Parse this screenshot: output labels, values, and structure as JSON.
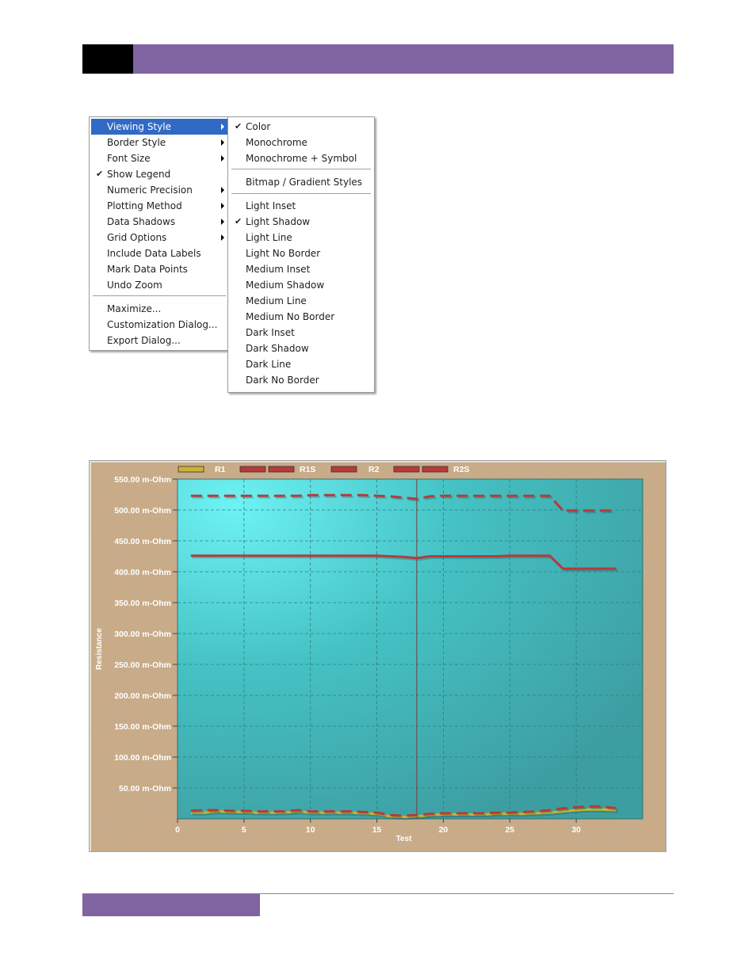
{
  "context_menu": {
    "items": [
      {
        "label": "Viewing Style",
        "submenu": true,
        "highlighted": true
      },
      {
        "label": "Border Style",
        "submenu": true
      },
      {
        "label": "Font Size",
        "submenu": true
      },
      {
        "label": "Show Legend",
        "checked": true
      },
      {
        "label": "Numeric Precision",
        "submenu": true
      },
      {
        "label": "Plotting Method",
        "submenu": true
      },
      {
        "label": "Data Shadows",
        "submenu": true
      },
      {
        "label": "Grid Options",
        "submenu": true
      },
      {
        "label": "Include Data Labels"
      },
      {
        "label": "Mark Data Points"
      },
      {
        "label": "Undo Zoom"
      },
      {
        "label": "Maximize..."
      },
      {
        "label": "Customization Dialog..."
      },
      {
        "label": "Export Dialog..."
      }
    ]
  },
  "viewing_style_submenu": {
    "items": [
      {
        "label": "Color",
        "checked": true
      },
      {
        "label": "Monochrome"
      },
      {
        "label": "Monochrome + Symbol"
      },
      {
        "label": "Bitmap / Gradient Styles"
      },
      {
        "label": "Light Inset"
      },
      {
        "label": "Light Shadow",
        "checked": true
      },
      {
        "label": "Light Line"
      },
      {
        "label": "Light No Border"
      },
      {
        "label": "Medium Inset"
      },
      {
        "label": "Medium Shadow"
      },
      {
        "label": "Medium Line"
      },
      {
        "label": "Medium No Border"
      },
      {
        "label": "Dark Inset"
      },
      {
        "label": "Dark Shadow"
      },
      {
        "label": "Dark Line"
      },
      {
        "label": "Dark No Border"
      }
    ]
  },
  "icons": {
    "check": "checkmark-icon",
    "submenu": "submenu-arrow-icon"
  },
  "colors": {
    "menu_highlight": "#316ac5",
    "header_purple": "#8064a2",
    "series_r1": "#c8b430",
    "series_r2": "#b83a3a"
  },
  "chart_data": {
    "type": "line",
    "xlabel": "Test",
    "ylabel": "Resistance",
    "xlim": [
      0,
      35
    ],
    "ylim": [
      0,
      550
    ],
    "x_ticks": [
      0,
      5,
      10,
      15,
      20,
      25,
      30
    ],
    "y_ticks": [
      {
        "value": 550,
        "label": "550.00 m-Ohm"
      },
      {
        "value": 500,
        "label": "500.00 m-Ohm"
      },
      {
        "value": 450,
        "label": "450.00 m-Ohm"
      },
      {
        "value": 400,
        "label": "400.00 m-Ohm"
      },
      {
        "value": 350,
        "label": "350.00 m-Ohm"
      },
      {
        "value": 300,
        "label": "300.00 m-Ohm"
      },
      {
        "value": 250,
        "label": "250.00 m-Ohm"
      },
      {
        "value": 200,
        "label": "200.00 m-Ohm"
      },
      {
        "value": 150,
        "label": "150.00 m-Ohm"
      },
      {
        "value": 100,
        "label": "100.00 m-Ohm"
      },
      {
        "value": 50,
        "label": "50.00 m-Ohm"
      }
    ],
    "grid": true,
    "legend_position": "top",
    "cursor_x": 18,
    "series": [
      {
        "name": "R1",
        "color": "#c8b430",
        "style": "solid",
        "x": [
          1,
          2,
          3,
          4,
          5,
          6,
          7,
          8,
          9,
          10,
          11,
          12,
          13,
          14,
          15,
          16,
          17,
          18,
          19,
          20,
          21,
          22,
          23,
          24,
          25,
          26,
          27,
          28,
          29,
          30,
          31,
          32,
          33
        ],
        "values": [
          10,
          10,
          12,
          11,
          11,
          10,
          10,
          10,
          12,
          10,
          10,
          10,
          10,
          9,
          8,
          4,
          3,
          4,
          6,
          7,
          7,
          7,
          7,
          8,
          8,
          8,
          9,
          10,
          12,
          14,
          15,
          15,
          14
        ]
      },
      {
        "name": "R1S",
        "color": "#b83a3a",
        "style": "dashed",
        "x": [
          1,
          2,
          3,
          4,
          5,
          6,
          7,
          8,
          9,
          10,
          11,
          12,
          13,
          14,
          15,
          16,
          17,
          18,
          19,
          20,
          21,
          22,
          23,
          24,
          25,
          26,
          27,
          28,
          29,
          30,
          31,
          32,
          33
        ],
        "values": [
          13,
          14,
          14,
          13,
          13,
          12,
          12,
          12,
          14,
          12,
          12,
          12,
          12,
          11,
          10,
          6,
          5,
          6,
          8,
          9,
          9,
          9,
          9,
          10,
          10,
          11,
          12,
          14,
          17,
          19,
          20,
          20,
          17
        ]
      },
      {
        "name": "R2",
        "color": "#b83a3a",
        "style": "solid",
        "x": [
          1,
          2,
          3,
          4,
          5,
          6,
          7,
          8,
          9,
          10,
          11,
          12,
          13,
          14,
          15,
          16,
          17,
          18,
          19,
          20,
          21,
          22,
          23,
          24,
          25,
          26,
          27,
          28,
          29,
          30,
          31,
          32,
          33
        ],
        "values": [
          426,
          426,
          426,
          426,
          426,
          426,
          426,
          426,
          426,
          426,
          426,
          426,
          426,
          426,
          426,
          425,
          424,
          422,
          425,
          425,
          425,
          425,
          425,
          425,
          426,
          426,
          426,
          426,
          405,
          405,
          405,
          405,
          405
        ]
      },
      {
        "name": "R2S",
        "color": "#b83a3a",
        "style": "dashed",
        "x": [
          1,
          2,
          3,
          4,
          5,
          6,
          7,
          8,
          9,
          10,
          11,
          12,
          13,
          14,
          15,
          16,
          17,
          18,
          19,
          20,
          21,
          22,
          23,
          24,
          25,
          26,
          27,
          28,
          29,
          30,
          31,
          32,
          33
        ],
        "values": [
          523,
          523,
          523,
          523,
          523,
          523,
          523,
          523,
          523,
          524,
          524,
          524,
          524,
          524,
          523,
          522,
          520,
          518,
          522,
          523,
          523,
          523,
          523,
          523,
          523,
          523,
          523,
          523,
          499,
          499,
          499,
          499,
          499
        ]
      }
    ]
  }
}
